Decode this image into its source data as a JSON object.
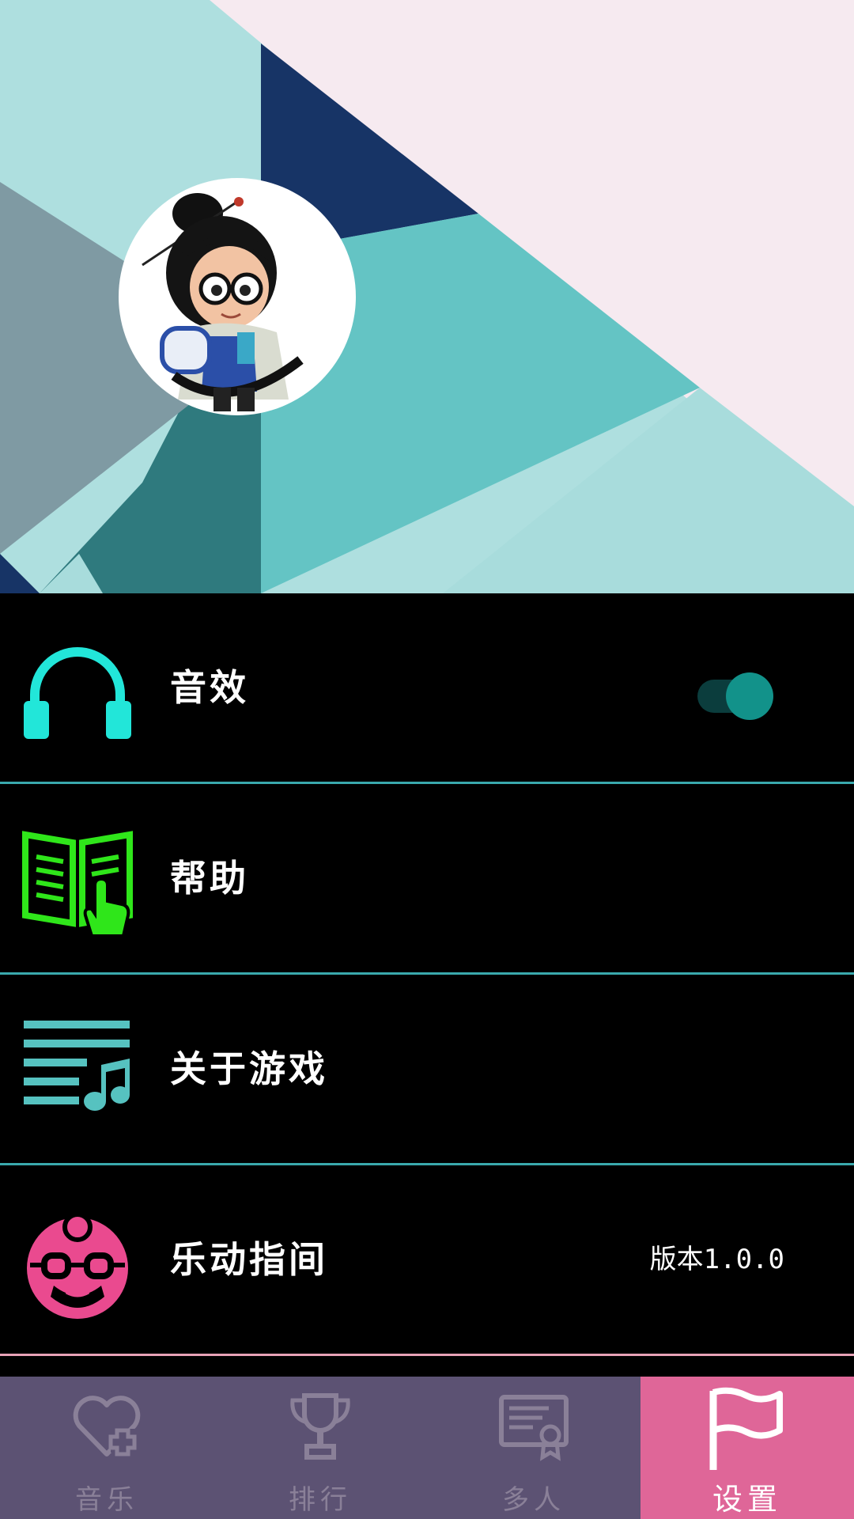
{
  "header": {
    "avatar": "character-avatar"
  },
  "settings": {
    "items": [
      {
        "label": "音效",
        "icon": "headphones-icon",
        "icon_color": "#22e6d9",
        "toggle_on": true
      },
      {
        "label": "帮助",
        "icon": "book-hand-icon",
        "icon_color": "#2fe61a"
      },
      {
        "label": "关于游戏",
        "icon": "music-list-icon",
        "icon_color": "#56c2c0"
      },
      {
        "label": "乐动指间",
        "icon": "developer-face-icon",
        "icon_color": "#ea4a8f",
        "extra": "版本1.0.0"
      }
    ]
  },
  "tabbar": {
    "tabs": [
      {
        "label": "音乐",
        "icon": "heart-plus-icon",
        "active": false
      },
      {
        "label": "排行",
        "icon": "trophy-icon",
        "active": false
      },
      {
        "label": "多人",
        "icon": "certificate-icon",
        "active": false
      },
      {
        "label": "设置",
        "icon": "flag-icon",
        "active": true
      }
    ]
  },
  "colors": {
    "tab_bg": "#5c5273",
    "tab_active": "#df6698",
    "divider": "#3aa9ad",
    "last_divider": "#e7a2b7",
    "toggle_knob": "#12928a"
  }
}
